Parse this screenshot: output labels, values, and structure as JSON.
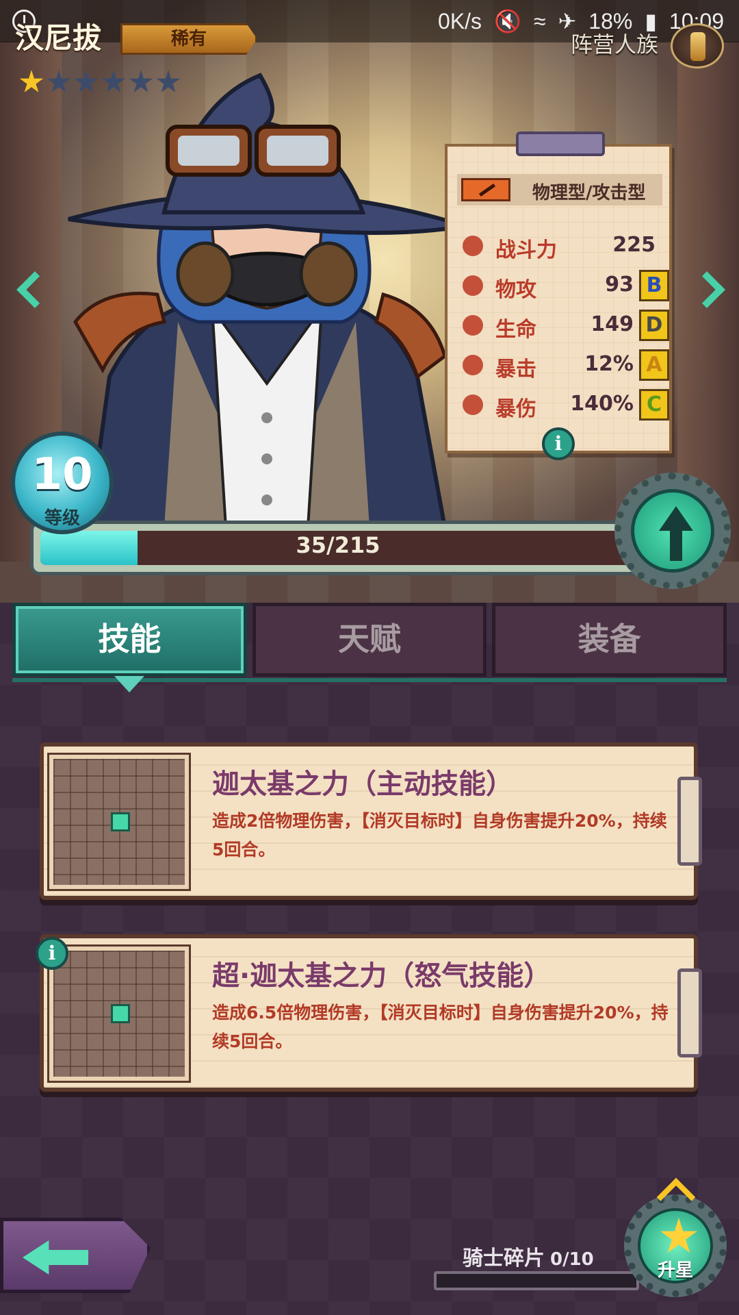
{
  "status_bar": {
    "speed": "0K/s",
    "battery": "18%",
    "time": "10:09"
  },
  "hero": {
    "name": "汉尼拔",
    "rarity": "稀有",
    "faction": "阵营人族",
    "stars_filled": 1,
    "stars_total": 6,
    "level": "10",
    "level_label": "等级",
    "xp_text": "35/215",
    "xp_fraction": 0.163
  },
  "stats": {
    "type": "物理型/攻击型",
    "power_label": "战斗力",
    "power_value": "225",
    "atk_label": "物攻",
    "atk_value": "93",
    "atk_grade": "B",
    "hp_label": "生命",
    "hp_value": "149",
    "hp_grade": "D",
    "crit_label": "暴击",
    "crit_value": "12%",
    "crit_grade": "A",
    "critdmg_label": "暴伤",
    "critdmg_value": "140%",
    "critdmg_grade": "C"
  },
  "tabs": {
    "skills": "技能",
    "talent": "天赋",
    "equipment": "装备"
  },
  "skills": [
    {
      "name": "迦太基之力（主动技能）",
      "desc": "造成2倍物理伤害，【消灭目标时】自身伤害提升20%，持续5回合。"
    },
    {
      "name": "超·迦太基之力（怒气技能）",
      "desc": "造成6.5倍物理伤害，【消灭目标时】自身伤害提升20%，持续5回合。"
    }
  ],
  "bottom": {
    "shard_label": "骑士碎片",
    "shard_count": "0/10",
    "shard_fraction": 0,
    "star_up_label": "升星"
  },
  "icons": {
    "info": "i",
    "colors": {
      "accent": "#2da28a",
      "tab_active": "#3a9a8e",
      "star": "#f7c524"
    }
  }
}
